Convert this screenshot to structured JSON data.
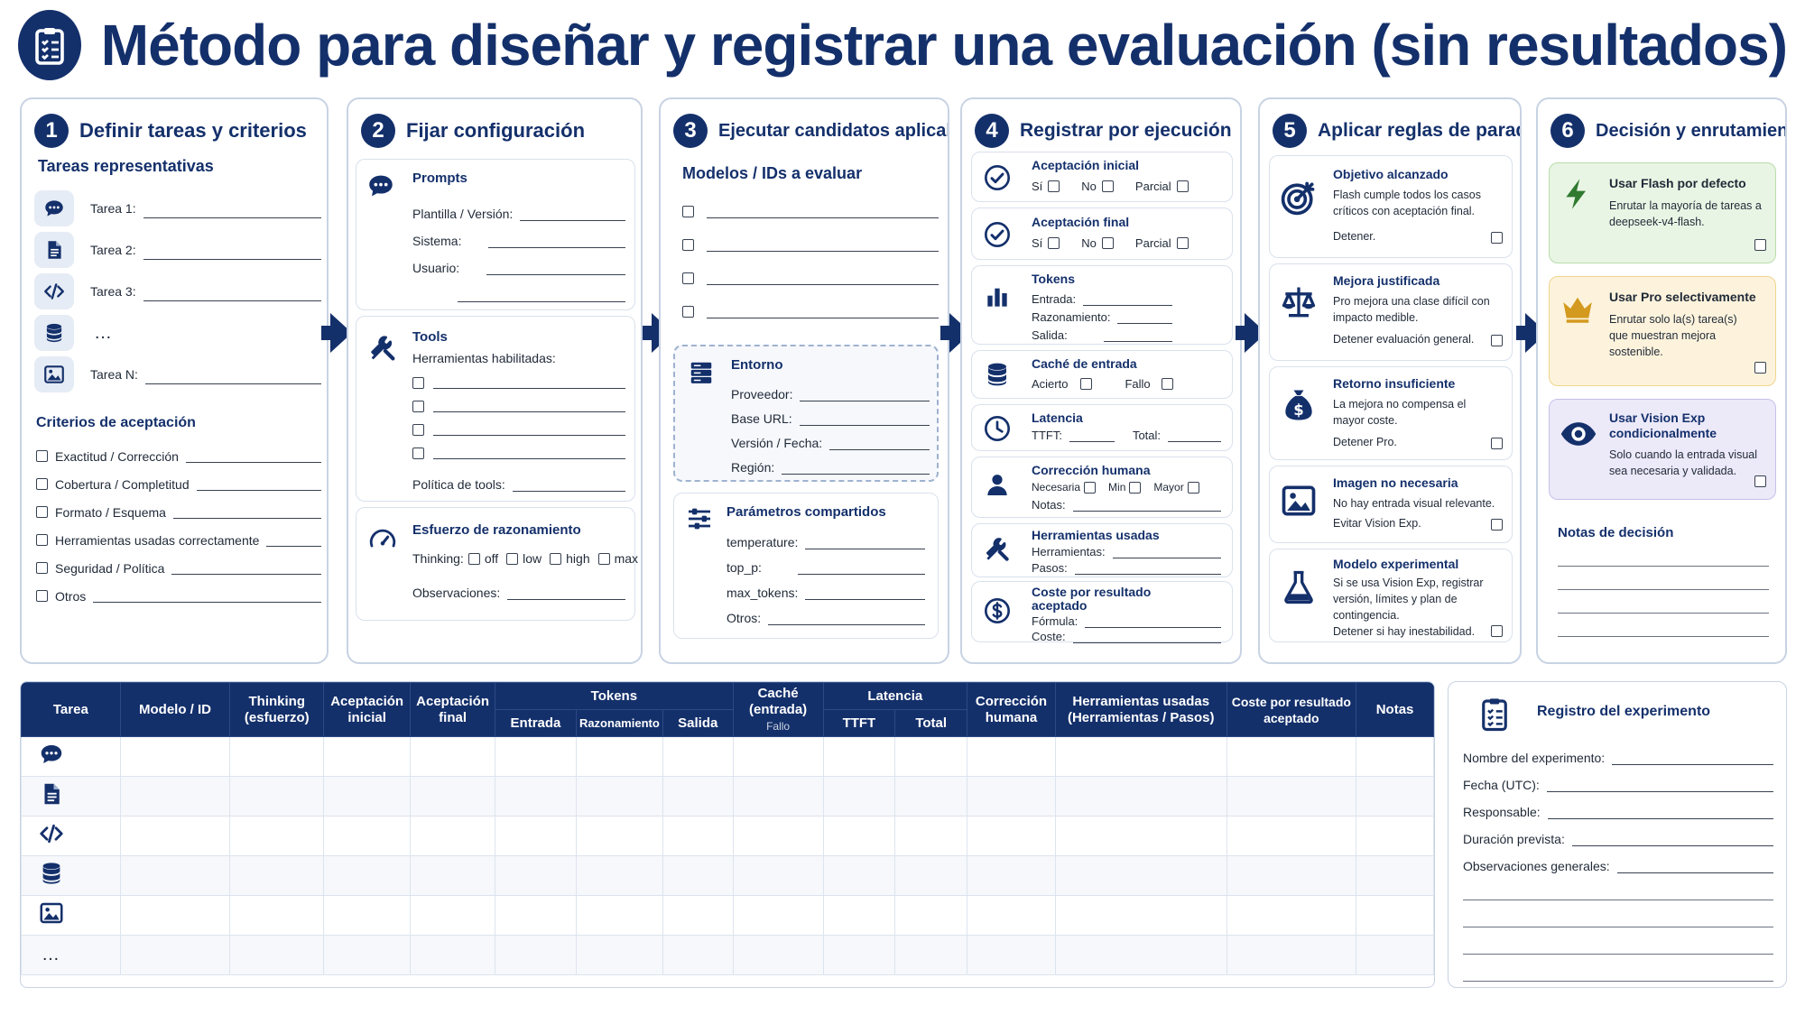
{
  "title": "Método para diseñar y registrar una evaluación (sin resultados)",
  "colors": {
    "navy": "#14306b",
    "green": "#e9f5e4",
    "yellow": "#fdf3dc",
    "purple": "#ece9f9"
  },
  "steps": [
    {
      "num": "1",
      "title": "Definir tareas y criterios"
    },
    {
      "num": "2",
      "title": "Fijar configuración"
    },
    {
      "num": "3",
      "title": "Ejecutar candidatos aplicables"
    },
    {
      "num": "4",
      "title": "Registrar por ejecución"
    },
    {
      "num": "5",
      "title": "Aplicar reglas de parada"
    },
    {
      "num": "6",
      "title": "Decisión y enrutamiento"
    }
  ],
  "p1": {
    "tasks_heading": "Tareas representativas",
    "tasks": [
      {
        "icon": "chat-icon",
        "label": "Tarea 1:"
      },
      {
        "icon": "document-icon",
        "label": "Tarea 2:"
      },
      {
        "icon": "code-icon",
        "label": "Tarea 3:"
      },
      {
        "icon": "database-icon",
        "label": "…"
      },
      {
        "icon": "image-icon",
        "label": "Tarea N:"
      }
    ],
    "criteria_heading": "Criterios de aceptación",
    "criteria": [
      "Exactitud / Corrección",
      "Cobertura / Completitud",
      "Formato / Esquema",
      "Herramientas usadas correctamente",
      "Seguridad / Política",
      "Otros"
    ]
  },
  "p2": {
    "prompts": {
      "title": "Prompts",
      "fields": [
        "Plantilla / Versión:",
        "Sistema:",
        "Usuario:"
      ]
    },
    "tools": {
      "title": "Tools",
      "sub": "Herramientas habilitadas:",
      "policy": "Política de tools:"
    },
    "reasoning": {
      "title": "Esfuerzo de razonamiento",
      "thinking": "Thinking:",
      "options": [
        "off",
        "low",
        "high",
        "max"
      ],
      "obs": "Observaciones:"
    }
  },
  "p3": {
    "models_heading": "Modelos / IDs a evaluar",
    "env": {
      "title": "Entorno",
      "fields": [
        "Proveedor:",
        "Base URL:",
        "Versión / Fecha:",
        "Región:"
      ]
    },
    "params": {
      "title": "Parámetros compartidos",
      "fields": [
        "temperature:",
        "top_p:",
        "max_tokens:",
        "Otros:"
      ]
    }
  },
  "p4": {
    "items": [
      {
        "icon": "check-circle-icon",
        "title": "Aceptación inicial",
        "opts": [
          "Sí",
          "No",
          "Parcial"
        ]
      },
      {
        "icon": "check-circle-icon",
        "title": "Aceptación final",
        "opts": [
          "Sí",
          "No",
          "Parcial"
        ]
      },
      {
        "icon": "bar-chart-icon",
        "title": "Tokens",
        "fields": [
          "Entrada:",
          "Razonamiento:",
          "Salida:"
        ]
      },
      {
        "icon": "database-icon",
        "title": "Caché de entrada",
        "opts": [
          "Acierto",
          "Fallo"
        ]
      },
      {
        "icon": "clock-icon",
        "title": "Latencia",
        "fields": [
          "TTFT:",
          "Total:"
        ]
      },
      {
        "icon": "person-icon",
        "title": "Corrección humana",
        "opts": [
          "Necesaria",
          "Min",
          "Mayor"
        ],
        "notes": "Notas:"
      },
      {
        "icon": "tools-icon",
        "title": "Herramientas usadas",
        "fields": [
          "Herramientas:",
          "Pasos:"
        ]
      },
      {
        "icon": "dollar-icon",
        "title": "Coste por resultado aceptado",
        "fields": [
          "Fórmula:",
          "Coste:"
        ]
      }
    ]
  },
  "p5": {
    "rules": [
      {
        "icon": "target-icon",
        "title": "Objetivo alcanzado",
        "text": "Flash cumple todos los casos críticos con aceptación final.",
        "action": "Detener."
      },
      {
        "icon": "scale-icon",
        "title": "Mejora justificada",
        "text": "Pro mejora una clase difícil con impacto medible.",
        "action": "Detener evaluación general."
      },
      {
        "icon": "money-bag-icon",
        "title": "Retorno insuficiente",
        "text": "La mejora no compensa el mayor coste.",
        "action": "Detener Pro."
      },
      {
        "icon": "image-icon",
        "title": "Imagen no necesaria",
        "text": "No hay entrada visual relevante.",
        "action": "Evitar Vision Exp."
      },
      {
        "icon": "flask-icon",
        "title": "Modelo experimental",
        "text": "Si se usa Vision Exp, registrar versión, límites y plan de contingencia.",
        "action": "Detener si hay inestabilidad."
      }
    ]
  },
  "p6": {
    "decisions": [
      {
        "icon": "lightning-icon",
        "title": "Usar Flash por defecto",
        "text": "Enrutar la mayoría de tareas a deepseek-v4-flash."
      },
      {
        "icon": "crown-icon",
        "title": "Usar Pro selectivamente",
        "text": "Enrutar solo la(s) tarea(s) que muestran mejora sostenible."
      },
      {
        "icon": "eye-icon",
        "title": "Usar Vision Exp condicionalmente",
        "text": "Solo cuando la entrada visual sea necesaria y validada."
      }
    ],
    "notes_heading": "Notas de decisión"
  },
  "table": {
    "headers": [
      "Tarea",
      "Modelo / ID",
      "Thinking (esfuerzo)",
      "Aceptación inicial",
      "Aceptación final",
      "Tokens",
      "Caché (entrada)",
      "Latencia",
      "Corrección humana",
      "Herramientas usadas (Herramientas / Pasos)",
      "Coste por resultado aceptado",
      "Notas"
    ],
    "tokens_sub": [
      "Entrada",
      "Razonamiento",
      "Salida"
    ],
    "cache_sub": "Fallo",
    "latency_sub": [
      "TTFT",
      "Total"
    ],
    "row_icons": [
      "chat-icon",
      "document-icon",
      "code-icon",
      "database-icon",
      "image-icon"
    ],
    "ellipsis": "…"
  },
  "registro": {
    "title": "Registro del experimento",
    "fields": [
      "Nombre del experimento:",
      "Fecha (UTC):",
      "Responsable:",
      "Duración prevista:",
      "Observaciones generales:"
    ]
  }
}
